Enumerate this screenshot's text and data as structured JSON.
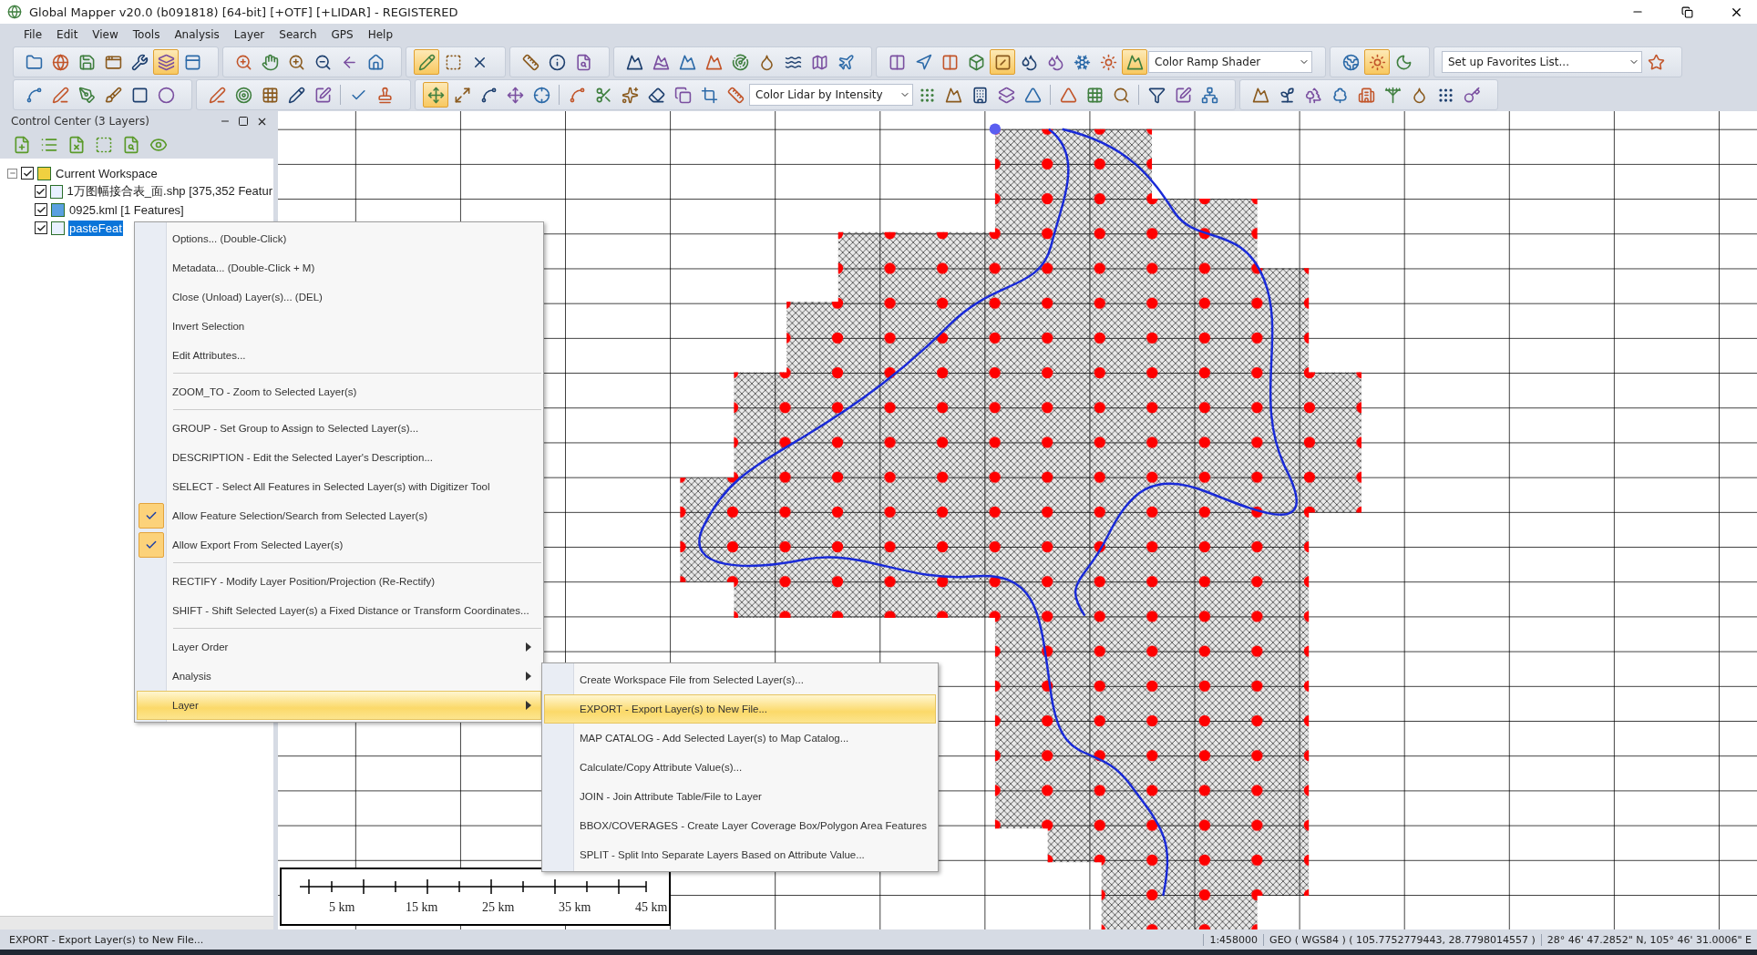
{
  "window": {
    "title": "Global Mapper v20.0 (b091818) [64-bit] [+OTF] [+LIDAR] - REGISTERED"
  },
  "menu": [
    {
      "label": "File"
    },
    {
      "label": "Edit"
    },
    {
      "label": "View"
    },
    {
      "label": "Tools"
    },
    {
      "label": "Analysis"
    },
    {
      "label": "Layer"
    },
    {
      "label": "Search"
    },
    {
      "label": "GPS"
    },
    {
      "label": "Help"
    }
  ],
  "toolbar_rows": [
    {
      "groups": [
        {
          "items": [
            {
              "kind": "button",
              "selected": false
            },
            {
              "kind": "button",
              "selected": false
            },
            {
              "kind": "button",
              "selected": false
            },
            {
              "kind": "button",
              "selected": false
            },
            {
              "kind": "button",
              "selected": false
            },
            {
              "kind": "button",
              "selected": true
            },
            {
              "kind": "button",
              "selected": false
            }
          ]
        },
        {
          "items": [
            {
              "kind": "button",
              "selected": false
            },
            {
              "kind": "button",
              "selected": false
            },
            {
              "kind": "button",
              "selected": false
            },
            {
              "kind": "button",
              "selected": false
            },
            {
              "kind": "button",
              "selected": false
            },
            {
              "kind": "button",
              "selected": false
            }
          ]
        },
        {
          "items": [
            {
              "kind": "button",
              "selected": true
            },
            {
              "kind": "button",
              "selected": false
            },
            {
              "kind": "button",
              "selected": false
            }
          ]
        },
        {
          "items": [
            {
              "kind": "button",
              "selected": false
            },
            {
              "kind": "button",
              "selected": false
            },
            {
              "kind": "button",
              "selected": false
            }
          ]
        },
        {
          "items": [
            {
              "kind": "button",
              "selected": false
            },
            {
              "kind": "button",
              "selected": false
            },
            {
              "kind": "button",
              "selected": false
            },
            {
              "kind": "button",
              "selected": false
            },
            {
              "kind": "button",
              "selected": false
            },
            {
              "kind": "button",
              "selected": false
            },
            {
              "kind": "button",
              "selected": false
            },
            {
              "kind": "button",
              "selected": false
            },
            {
              "kind": "button",
              "selected": false
            }
          ]
        },
        {
          "items": [
            {
              "kind": "button",
              "selected": false
            },
            {
              "kind": "button",
              "selected": false
            },
            {
              "kind": "button",
              "selected": false
            },
            {
              "kind": "button",
              "selected": false
            },
            {
              "kind": "button",
              "selected": true
            },
            {
              "kind": "button",
              "selected": false
            },
            {
              "kind": "button",
              "selected": false
            },
            {
              "kind": "button",
              "selected": false
            },
            {
              "kind": "button",
              "selected": false
            },
            {
              "kind": "button",
              "selected": true
            },
            {
              "kind": "dropdown",
              "value": "Color Ramp Shader"
            }
          ]
        },
        {
          "items": [
            {
              "kind": "button",
              "selected": false
            },
            {
              "kind": "button",
              "selected": true
            },
            {
              "kind": "button",
              "selected": false
            }
          ]
        },
        {
          "items": [
            {
              "kind": "dropdown",
              "value": "Set up Favorites List..."
            },
            {
              "kind": "button",
              "selected": false
            }
          ]
        }
      ]
    },
    {
      "groups": [
        {
          "items": [
            {
              "kind": "button",
              "selected": false
            },
            {
              "kind": "button",
              "selected": false
            },
            {
              "kind": "button",
              "selected": false
            },
            {
              "kind": "button",
              "selected": false
            },
            {
              "kind": "button",
              "selected": false
            },
            {
              "kind": "button",
              "selected": false
            }
          ]
        },
        {
          "items": [
            {
              "kind": "button",
              "selected": false
            },
            {
              "kind": "button",
              "selected": false
            },
            {
              "kind": "button",
              "selected": false
            },
            {
              "kind": "button",
              "selected": false
            },
            {
              "kind": "button",
              "selected": false
            },
            {
              "kind": "separator"
            },
            {
              "kind": "button",
              "selected": false
            },
            {
              "kind": "button",
              "selected": false
            }
          ]
        },
        {
          "items": [
            {
              "kind": "button",
              "selected": true
            },
            {
              "kind": "button",
              "selected": false
            },
            {
              "kind": "button",
              "selected": false
            },
            {
              "kind": "button",
              "selected": false
            },
            {
              "kind": "button",
              "selected": false
            },
            {
              "kind": "separator"
            },
            {
              "kind": "button",
              "selected": false
            },
            {
              "kind": "button",
              "selected": false
            },
            {
              "kind": "button",
              "selected": false
            },
            {
              "kind": "button",
              "selected": false
            },
            {
              "kind": "button",
              "selected": false
            },
            {
              "kind": "button",
              "selected": false
            },
            {
              "kind": "button",
              "selected": false
            },
            {
              "kind": "dropdown",
              "value": "Color Lidar by Intensity"
            },
            {
              "kind": "button",
              "selected": false
            },
            {
              "kind": "button",
              "selected": false
            },
            {
              "kind": "button",
              "selected": false
            },
            {
              "kind": "button",
              "selected": false
            },
            {
              "kind": "button",
              "selected": false
            },
            {
              "kind": "separator"
            },
            {
              "kind": "button",
              "selected": false
            },
            {
              "kind": "button",
              "selected": false
            },
            {
              "kind": "button",
              "selected": false
            },
            {
              "kind": "separator"
            },
            {
              "kind": "button",
              "selected": false
            },
            {
              "kind": "button",
              "selected": false
            },
            {
              "kind": "button",
              "selected": false
            }
          ]
        },
        {
          "items": [
            {
              "kind": "button",
              "selected": false
            },
            {
              "kind": "button",
              "selected": false
            },
            {
              "kind": "button",
              "selected": false
            },
            {
              "kind": "button",
              "selected": false
            },
            {
              "kind": "button",
              "selected": false
            },
            {
              "kind": "button",
              "selected": false
            },
            {
              "kind": "button",
              "selected": false
            },
            {
              "kind": "button",
              "selected": false
            },
            {
              "kind": "button",
              "selected": false
            }
          ]
        }
      ]
    }
  ],
  "control_center": {
    "title": "Control Center (3 Layers)",
    "tree": [
      {
        "label": "Current Workspace",
        "checked": true,
        "expanded": true,
        "selected": false,
        "children": [
          {
            "label": "1万图幅接合表_面.shp [375,352 Featur",
            "checked": true,
            "selected": false
          },
          {
            "label": "0925.kml [1 Features]",
            "checked": true,
            "selected": false
          },
          {
            "label": "pasteFeat",
            "checked": true,
            "selected": true
          }
        ]
      }
    ]
  },
  "context_menu": {
    "items": [
      {
        "kind": "item",
        "label": "Options... (Double-Click)",
        "checked": false,
        "submenu": false,
        "selected": false
      },
      {
        "kind": "item",
        "label": "Metadata... (Double-Click + M)",
        "checked": false,
        "submenu": false,
        "selected": false
      },
      {
        "kind": "item",
        "label": "Close (Unload) Layer(s)... (DEL)",
        "checked": false,
        "submenu": false,
        "selected": false
      },
      {
        "kind": "item",
        "label": "Invert Selection",
        "checked": false,
        "submenu": false,
        "selected": false
      },
      {
        "kind": "item",
        "label": "Edit Attributes...",
        "checked": false,
        "submenu": false,
        "selected": false
      },
      {
        "kind": "separator"
      },
      {
        "kind": "item",
        "label": "ZOOM_TO - Zoom to Selected Layer(s)",
        "checked": false,
        "submenu": false,
        "selected": false
      },
      {
        "kind": "separator"
      },
      {
        "kind": "item",
        "label": "GROUP - Set Group to Assign to Selected Layer(s)...",
        "checked": false,
        "submenu": false,
        "selected": false
      },
      {
        "kind": "item",
        "label": "DESCRIPTION - Edit the Selected Layer's Description...",
        "checked": false,
        "submenu": false,
        "selected": false
      },
      {
        "kind": "item",
        "label": "SELECT - Select All Features in Selected Layer(s) with Digitizer Tool",
        "checked": false,
        "submenu": false,
        "selected": false
      },
      {
        "kind": "item",
        "label": "Allow Feature Selection/Search from Selected Layer(s)",
        "checked": true,
        "submenu": false,
        "selected": false
      },
      {
        "kind": "item",
        "label": "Allow Export From Selected Layer(s)",
        "checked": true,
        "submenu": false,
        "selected": false
      },
      {
        "kind": "separator"
      },
      {
        "kind": "item",
        "label": "RECTIFY - Modify Layer Position/Projection (Re-Rectify)",
        "checked": false,
        "submenu": false,
        "selected": false
      },
      {
        "kind": "item",
        "label": "SHIFT - Shift Selected Layer(s) a Fixed Distance or Transform Coordinates...",
        "checked": false,
        "submenu": false,
        "selected": false
      },
      {
        "kind": "separator"
      },
      {
        "kind": "item",
        "label": "Layer Order",
        "checked": false,
        "submenu": true,
        "selected": false
      },
      {
        "kind": "item",
        "label": "Analysis",
        "checked": false,
        "submenu": true,
        "selected": false
      },
      {
        "kind": "item",
        "label": "Layer",
        "checked": false,
        "submenu": true,
        "selected": true
      }
    ]
  },
  "submenu": {
    "items": [
      {
        "label": "Create Workspace File from Selected Layer(s)...",
        "selected": false
      },
      {
        "label": "EXPORT - Export Layer(s) to New File...",
        "selected": true
      },
      {
        "label": "MAP CATALOG - Add Selected Layer(s) to Map Catalog...",
        "selected": false
      },
      {
        "label": "Calculate/Copy Attribute Value(s)...",
        "selected": false
      },
      {
        "label": "JOIN - Join Attribute Table/File to Layer",
        "selected": false
      },
      {
        "label": "BBOX/COVERAGES  - Create Layer Coverage Box/Polygon Area Features",
        "selected": false
      },
      {
        "label": "SPLIT - Split Into Separate Layers Based on Attribute Value...",
        "selected": false
      }
    ]
  },
  "scale_bar": {
    "labels": [
      "5 km",
      "15 km",
      "25 km",
      "35 km",
      "45 km"
    ]
  },
  "status_bar": {
    "message": "EXPORT - Export Layer(s) to New File...",
    "scale": "1:458000",
    "coordinates": "GEO ( WGS84 ) ( 105.7752779443, 28.7798014557 )",
    "position": "28° 46' 47.2852\" N, 105° 46' 31.0006\" E"
  }
}
